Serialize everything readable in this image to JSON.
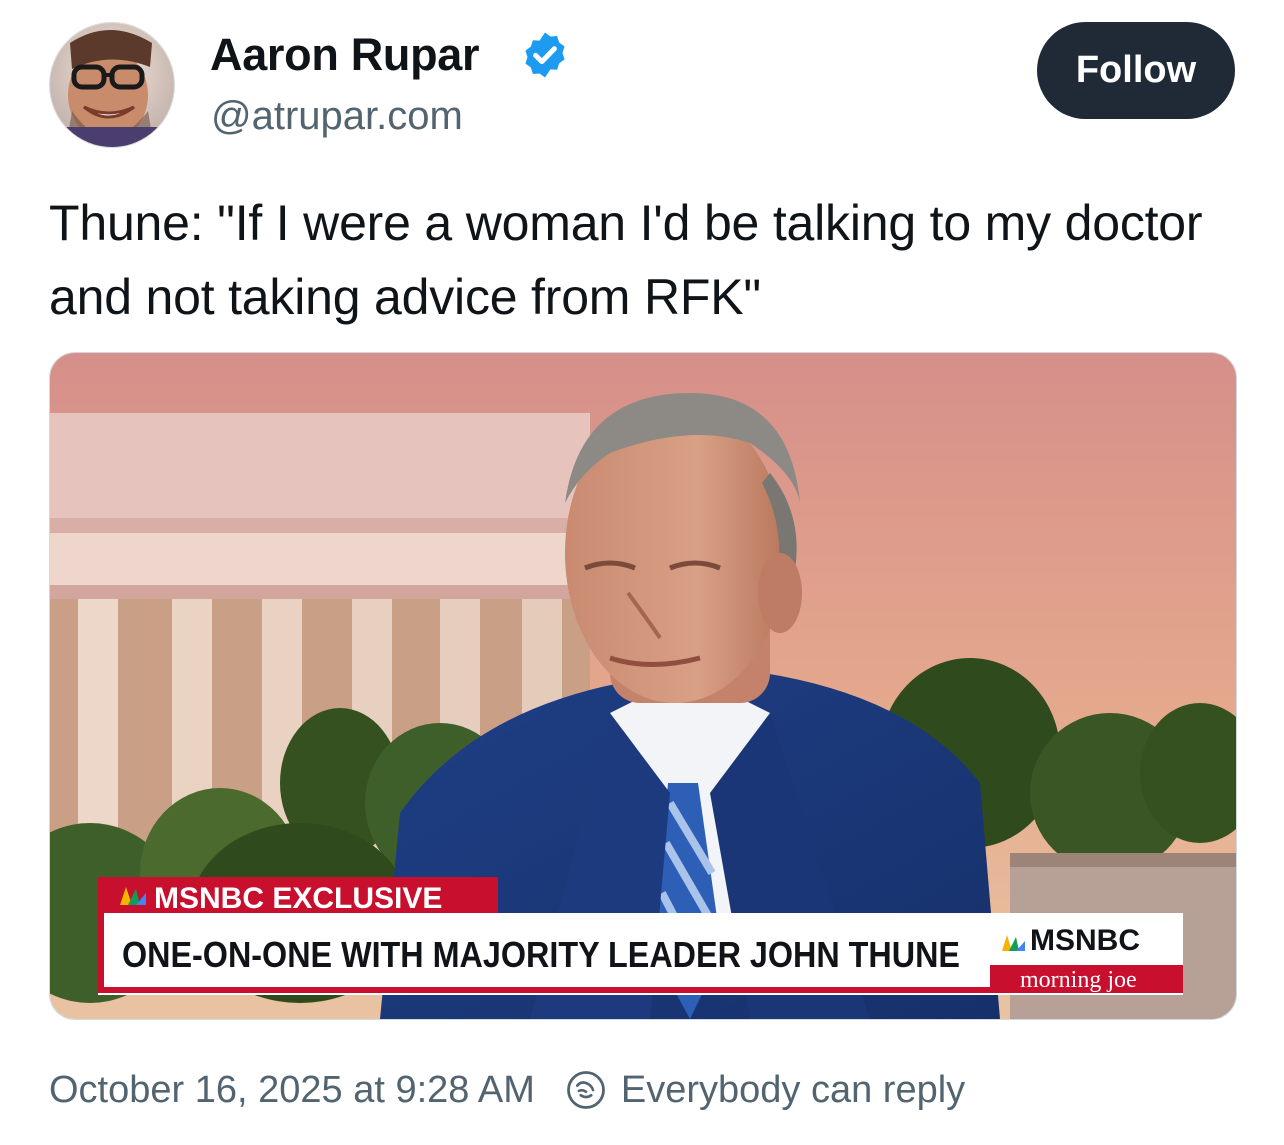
{
  "author": {
    "name": "Aaron Rupar",
    "handle": "@atrupar.com",
    "verified_icon": "verified-check-icon",
    "verified_color": "#1d9bf0"
  },
  "follow_label": "Follow",
  "post": {
    "text": "Thune: \"If I were a woman I'd be talking to my doctor and not taking advice from RFK\""
  },
  "media": {
    "exclusive_label": "MSNBC EXCLUSIVE",
    "headline": "ONE-ON-ONE WITH MAJORITY LEADER JOHN THUNE",
    "network": "MSNBC",
    "show": "morning joe"
  },
  "footer": {
    "timestamp": "October 16, 2025 at 9:28 AM",
    "reply_icon": "reply-settings-icon",
    "reply_setting": "Everybody can reply"
  },
  "colors": {
    "follow_bg": "#1f2a36",
    "secondary_text": "#536471",
    "ticker_red": "#c8102e"
  }
}
